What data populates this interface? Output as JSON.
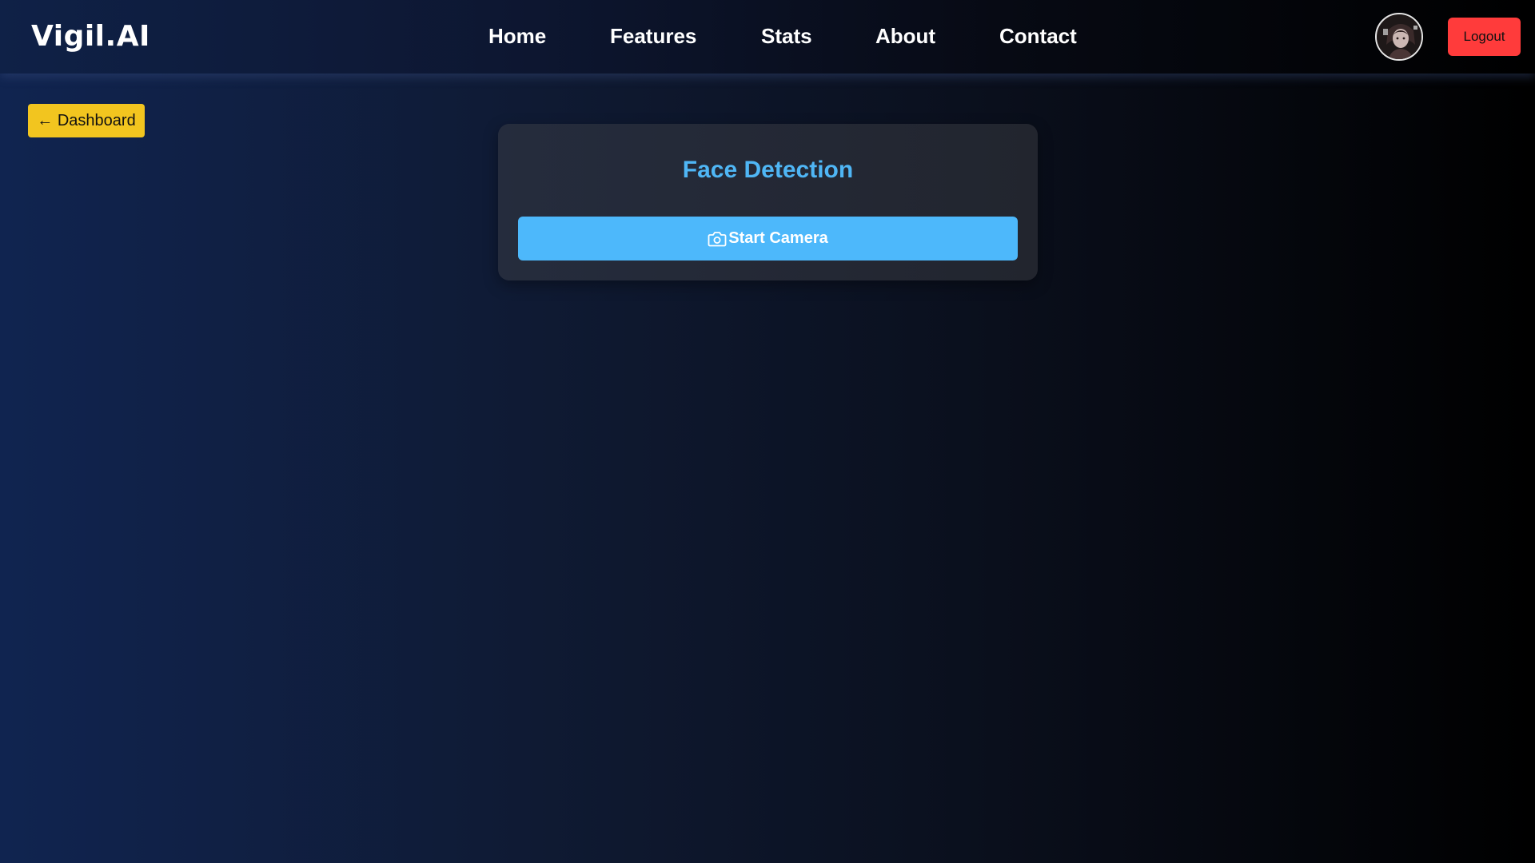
{
  "header": {
    "brand": "Vigil.AI",
    "nav": [
      {
        "label": "Home"
      },
      {
        "label": "Features"
      },
      {
        "label": "Stats"
      },
      {
        "label": "About"
      },
      {
        "label": "Contact"
      }
    ],
    "avatar_icon": "user-avatar",
    "logout_label": "Logout"
  },
  "back": {
    "label": "← Dashboard"
  },
  "card": {
    "title": "Face Detection",
    "button_label": "Start Camera",
    "button_icon": "camera-icon"
  },
  "colors": {
    "accent": "#4db8fb",
    "title": "#4fb6f5",
    "logout": "#ff3b3b",
    "back_button": "#f2c51f"
  }
}
